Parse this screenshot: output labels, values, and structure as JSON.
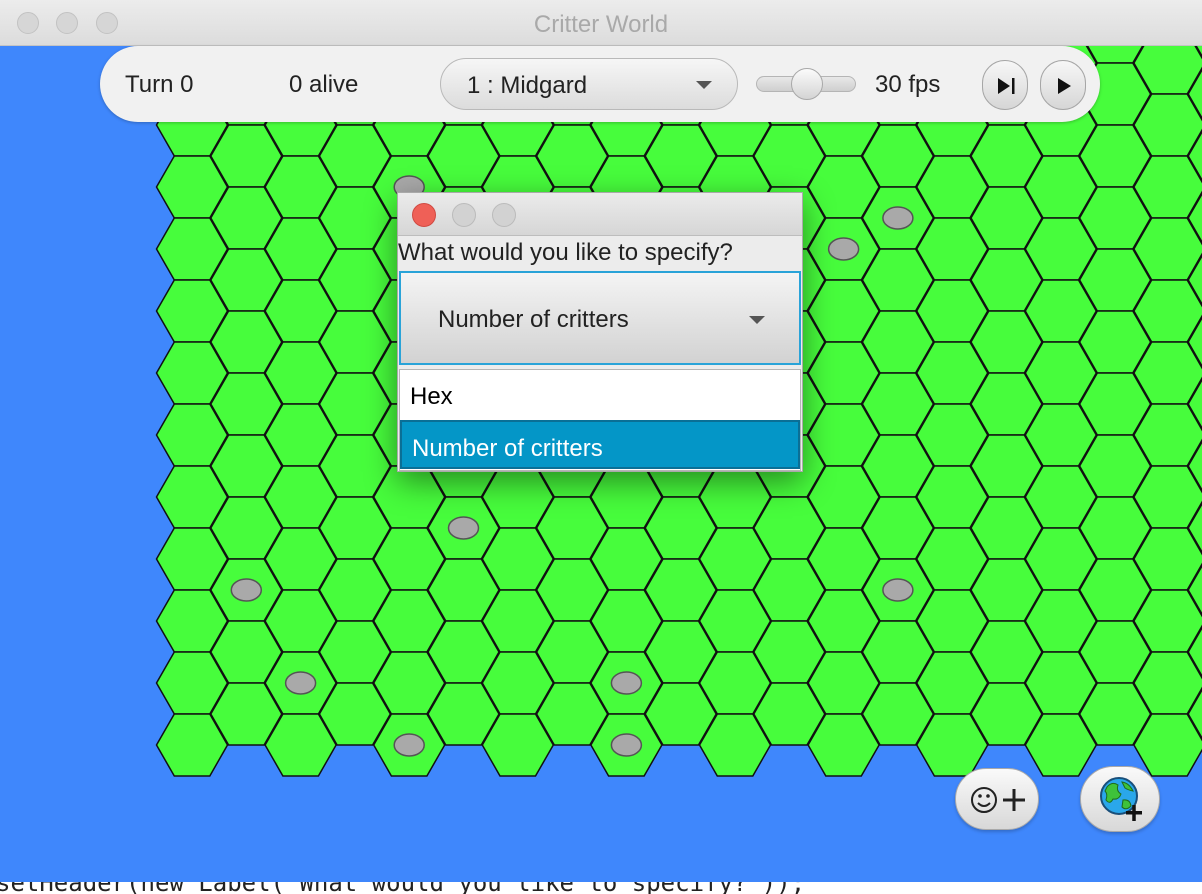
{
  "window": {
    "title": "Critter World"
  },
  "toolbar": {
    "turn_label": "Turn 0",
    "alive_label": "0 alive",
    "world_select_value": "1 : Midgard",
    "speed": 0.5,
    "fps_label": "30 fps",
    "step_icon": "step-forward-icon",
    "play_icon": "play-icon"
  },
  "board": {
    "hex_color": "#47fd3c",
    "background_color": "#3f87fc",
    "rocks": [
      [
        4,
        1
      ],
      [
        12,
        2
      ],
      [
        13,
        2
      ],
      [
        10,
        5
      ],
      [
        5,
        7
      ],
      [
        1,
        8
      ],
      [
        13,
        8
      ],
      [
        2,
        9
      ],
      [
        8,
        9
      ],
      [
        4,
        10
      ],
      [
        8,
        10
      ]
    ]
  },
  "dialog": {
    "prompt": "What would you like to specify?",
    "selected_value": "Number of critters",
    "options": [
      {
        "label": "Hex",
        "selected": false
      },
      {
        "label": "Number of critters",
        "selected": true
      }
    ]
  },
  "buttons": {
    "add_critter_icon": "smiley-plus-icon",
    "add_world_icon": "globe-plus-icon"
  },
  "code_line": "setHeader(new Label(\"What would you like to specify?\"));"
}
